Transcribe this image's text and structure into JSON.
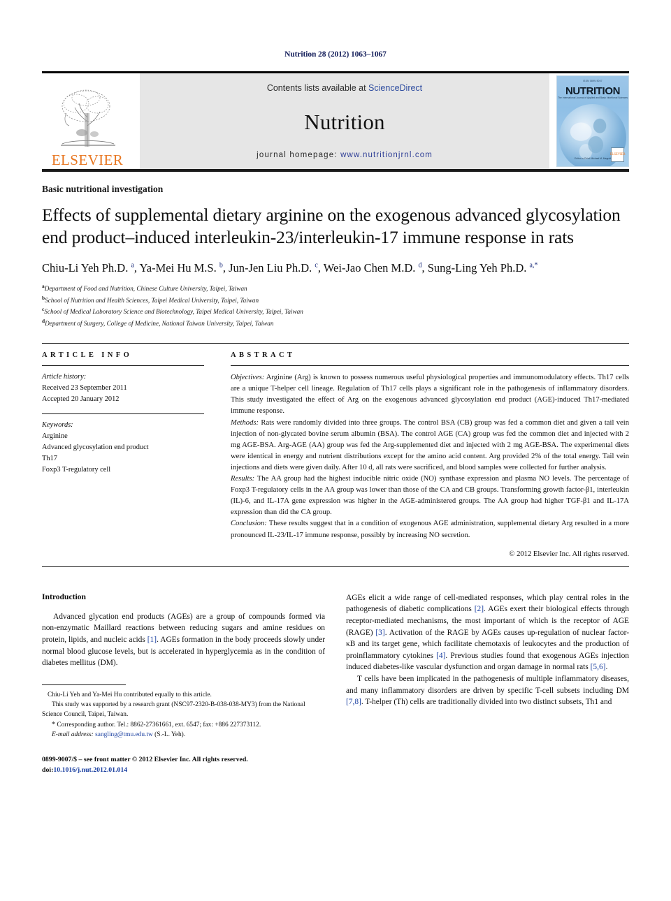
{
  "running_head": "Nutrition 28 (2012) 1063–1067",
  "masthead": {
    "publisher_name": "ELSEVIER",
    "contents_prefix": "Contents lists available at ",
    "contents_link": "ScienceDirect",
    "journal_name": "Nutrition",
    "homepage_prefix": "journal homepage: ",
    "homepage_url": "www.nutritionjrnl.com",
    "cover": {
      "top_line": "ISSN 0899-9007",
      "title": "NUTRITION",
      "subtitle": "The International Journal of Applied and Basic Nutritional Sciences",
      "footer": "Editor-in-Chief: Michael M. Meguid",
      "badge": "ELSEVIER"
    }
  },
  "article": {
    "kind": "Basic nutritional investigation",
    "title": "Effects of supplemental dietary arginine on the exogenous advanced glycosylation end product–induced interleukin-23/interleukin-17 immune response in rats",
    "authors_html": "Chiu-Li Yeh Ph.D. <sup>a</sup>, Ya-Mei Hu M.S. <sup>b</sup>, Jun-Jen Liu Ph.D. <sup>c</sup>, Wei-Jao Chen M.D. <sup>d</sup>, Sung-Ling Yeh Ph.D. <sup>a,*</sup>",
    "affiliations": [
      {
        "mark": "a",
        "text": "Department of Food and Nutrition, Chinese Culture University, Taipei, Taiwan"
      },
      {
        "mark": "b",
        "text": "School of Nutrition and Health Sciences, Taipei Medical University, Taipei, Taiwan"
      },
      {
        "mark": "c",
        "text": "School of Medical Laboratory Science and Biotechnology, Taipei Medical University, Taipei, Taiwan"
      },
      {
        "mark": "d",
        "text": "Department of Surgery, College of Medicine, National Taiwan University, Taipei, Taiwan"
      }
    ]
  },
  "article_info": {
    "heading": "ARTICLE INFO",
    "history_label": "Article history:",
    "received": "Received 23 September 2011",
    "accepted": "Accepted 20 January 2012",
    "keywords_label": "Keywords:",
    "keywords": [
      "Arginine",
      "Advanced glycosylation end product",
      "Th17",
      "Foxp3 T-regulatory cell"
    ]
  },
  "abstract": {
    "heading": "ABSTRACT",
    "objectives_label": "Objectives:",
    "objectives": " Arginine (Arg) is known to possess numerous useful physiological properties and immunomodulatory effects. Th17 cells are a unique T-helper cell lineage. Regulation of Th17 cells plays a significant role in the pathogenesis of inflammatory disorders. This study investigated the effect of Arg on the exogenous advanced glycosylation end product (AGE)-induced Th17-mediated immune response.",
    "methods_label": "Methods:",
    "methods": " Rats were randomly divided into three groups. The control BSA (CB) group was fed a common diet and given a tail vein injection of non-glycated bovine serum albumin (BSA). The control AGE (CA) group was fed the common diet and injected with 2 mg AGE-BSA. Arg-AGE (AA) group was fed the Arg-supplemented diet and injected with 2 mg AGE-BSA. The experimental diets were identical in energy and nutrient distributions except for the amino acid content. Arg provided 2% of the total energy. Tail vein injections and diets were given daily. After 10 d, all rats were sacrificed, and blood samples were collected for further analysis.",
    "results_label": "Results:",
    "results": " The AA group had the highest inducible nitric oxide (NO) synthase expression and plasma NO levels. The percentage of Foxp3 T-regulatory cells in the AA group was lower than those of the CA and CB groups. Transforming growth factor-β1, interleukin (IL)-6, and IL-17A gene expression was higher in the AGE-administered groups. The AA group had higher TGF-β1 and IL-17A expression than did the CA group.",
    "conclusion_label": "Conclusion:",
    "conclusion": " These results suggest that in a condition of exogenous AGE administration, supplemental dietary Arg resulted in a more pronounced IL-23/IL-17 immune response, possibly by increasing NO secretion.",
    "copyright": "© 2012 Elsevier Inc. All rights reserved."
  },
  "introduction": {
    "heading": "Introduction",
    "left_paragraph_1_a": "Advanced glycation end products (AGEs) are a group of compounds formed via non-enzymatic Maillard reactions between reducing sugars and amine residues on protein, lipids, and nucleic acids ",
    "left_ref_1": "[1]",
    "left_paragraph_1_b": ". AGEs formation in the body proceeds slowly under normal blood glucose levels, but is accelerated in hyperglycemia as in the condition of diabetes mellitus (DM).",
    "right_p1_a": "AGEs elicit a wide range of cell-mediated responses, which play central roles in the pathogenesis of diabetic complications ",
    "right_ref_2": "[2]",
    "right_p1_b": ". AGEs exert their biological effects through receptor-mediated mechanisms, the most important of which is the receptor of AGE (RAGE) ",
    "right_ref_3": "[3]",
    "right_p1_c": ". Activation of the RAGE by AGEs causes up-regulation of nuclear factor-κB and its target gene, which facilitate chemotaxis of leukocytes and the production of proinflammatory cytokines ",
    "right_ref_4": "[4]",
    "right_p1_d": ". Previous studies found that exogenous AGEs injection induced diabetes-like vascular dysfunction and organ damage in normal rats ",
    "right_ref_56": "[5,6]",
    "right_p1_e": ".",
    "right_p2_a": "T cells have been implicated in the pathogenesis of multiple inflammatory diseases, and many inflammatory disorders are driven by specific T-cell subsets including DM ",
    "right_ref_78": "[7,8]",
    "right_p2_b": ". T-helper (Th) cells are traditionally divided into two distinct subsets, Th1 and"
  },
  "footnotes": {
    "line1": "Chiu-Li Yeh and Ya-Mei Hu contributed equally to this article.",
    "line2": "This study was supported by a research grant (NSC97-2320-B-038-038-MY3) from the National Science Council, Taipei, Taiwan.",
    "corresponding_star": "*",
    "line3": " Corresponding author. Tel.: 8862-27361661, ext. 6547; fax: +886 227373112.",
    "email_label": "E-mail address:",
    "email": "sangling@tmu.edu.tw",
    "email_suffix": " (S.-L. Yeh)."
  },
  "imprint": {
    "line1": "0899-9007/$ – see front matter © 2012 Elsevier Inc. All rights reserved.",
    "doi_label": "doi:",
    "doi": "10.1016/j.nut.2012.01.014"
  }
}
